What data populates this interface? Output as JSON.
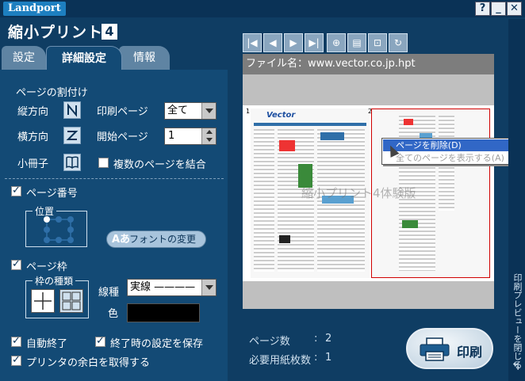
{
  "titlebar": {
    "logo": "Landport",
    "help": "?",
    "minimize": "_",
    "close": "✕"
  },
  "app": {
    "name": "縮小プリント",
    "version": "4"
  },
  "tabs": [
    {
      "label": "設定"
    },
    {
      "label": "詳細設定"
    },
    {
      "label": "情報"
    }
  ],
  "layout_section": {
    "title": "ページの割付け",
    "vertical_label": "縦方向",
    "horizontal_label": "横方向",
    "booklet_label": "小冊子",
    "print_page_label": "印刷ページ",
    "print_page_value": "全て",
    "start_page_label": "開始ページ",
    "start_page_value": "1",
    "combine_label": "複数のページを結合",
    "combine_checked": false
  },
  "page_number": {
    "label": "ページ番号",
    "checked": true,
    "position_title": "位置",
    "font_button": "フォントの変更",
    "font_icon_text": "Aあ"
  },
  "page_frame": {
    "label": "ページ枠",
    "checked": true,
    "frame_type_title": "枠の種類",
    "line_type_label": "線種",
    "line_type_value": "実線 ————",
    "color_label": "色",
    "color_value": "#000000"
  },
  "options": {
    "auto_exit_label": "自動終了",
    "auto_exit_checked": true,
    "save_on_exit_label": "終了時の設定を保存",
    "save_on_exit_checked": true,
    "printer_margin_label": "プリンタの余白を取得する",
    "printer_margin_checked": true
  },
  "preview": {
    "filename_label": "ファイル名：www.vector.co.jp.hpt",
    "page1_number": "1",
    "page2_number": "2",
    "page1_logo": "Vector",
    "watermark": "縮小プリント4体験版"
  },
  "context_menu": {
    "delete_page": "ページを削除(D)",
    "show_all": "全てのページを表示する(A)"
  },
  "stats": {
    "pages_label": "ページ数",
    "pages_value": "2",
    "sheets_label": "必要用紙枚数",
    "sheets_value": "1",
    "sep": ":"
  },
  "print_button": {
    "label": "印刷"
  },
  "side": {
    "close_preview": "印刷プレビューを閉じる"
  },
  "colors": {
    "background": "#0f3d63",
    "panel": "#134a75",
    "accent": "#3167c6",
    "frame_red": "#d00000"
  }
}
